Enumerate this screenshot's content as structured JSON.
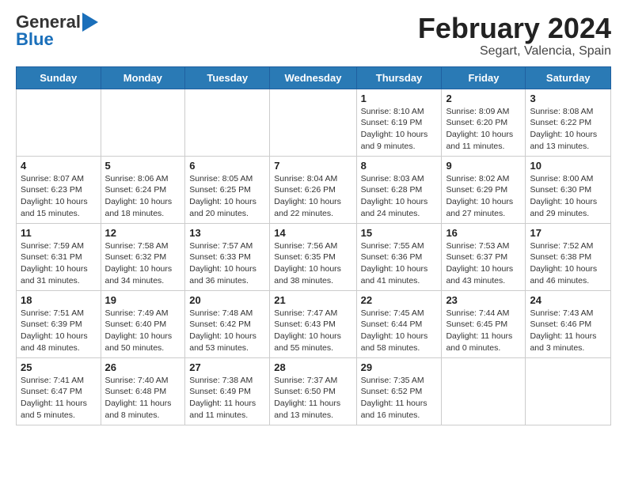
{
  "header": {
    "logo_general": "General",
    "logo_blue": "Blue",
    "month_title": "February 2024",
    "location": "Segart, Valencia, Spain"
  },
  "days_of_week": [
    "Sunday",
    "Monday",
    "Tuesday",
    "Wednesday",
    "Thursday",
    "Friday",
    "Saturday"
  ],
  "weeks": [
    [
      {
        "day": "",
        "info": ""
      },
      {
        "day": "",
        "info": ""
      },
      {
        "day": "",
        "info": ""
      },
      {
        "day": "",
        "info": ""
      },
      {
        "day": "1",
        "info": "Sunrise: 8:10 AM\nSunset: 6:19 PM\nDaylight: 10 hours\nand 9 minutes."
      },
      {
        "day": "2",
        "info": "Sunrise: 8:09 AM\nSunset: 6:20 PM\nDaylight: 10 hours\nand 11 minutes."
      },
      {
        "day": "3",
        "info": "Sunrise: 8:08 AM\nSunset: 6:22 PM\nDaylight: 10 hours\nand 13 minutes."
      }
    ],
    [
      {
        "day": "4",
        "info": "Sunrise: 8:07 AM\nSunset: 6:23 PM\nDaylight: 10 hours\nand 15 minutes."
      },
      {
        "day": "5",
        "info": "Sunrise: 8:06 AM\nSunset: 6:24 PM\nDaylight: 10 hours\nand 18 minutes."
      },
      {
        "day": "6",
        "info": "Sunrise: 8:05 AM\nSunset: 6:25 PM\nDaylight: 10 hours\nand 20 minutes."
      },
      {
        "day": "7",
        "info": "Sunrise: 8:04 AM\nSunset: 6:26 PM\nDaylight: 10 hours\nand 22 minutes."
      },
      {
        "day": "8",
        "info": "Sunrise: 8:03 AM\nSunset: 6:28 PM\nDaylight: 10 hours\nand 24 minutes."
      },
      {
        "day": "9",
        "info": "Sunrise: 8:02 AM\nSunset: 6:29 PM\nDaylight: 10 hours\nand 27 minutes."
      },
      {
        "day": "10",
        "info": "Sunrise: 8:00 AM\nSunset: 6:30 PM\nDaylight: 10 hours\nand 29 minutes."
      }
    ],
    [
      {
        "day": "11",
        "info": "Sunrise: 7:59 AM\nSunset: 6:31 PM\nDaylight: 10 hours\nand 31 minutes."
      },
      {
        "day": "12",
        "info": "Sunrise: 7:58 AM\nSunset: 6:32 PM\nDaylight: 10 hours\nand 34 minutes."
      },
      {
        "day": "13",
        "info": "Sunrise: 7:57 AM\nSunset: 6:33 PM\nDaylight: 10 hours\nand 36 minutes."
      },
      {
        "day": "14",
        "info": "Sunrise: 7:56 AM\nSunset: 6:35 PM\nDaylight: 10 hours\nand 38 minutes."
      },
      {
        "day": "15",
        "info": "Sunrise: 7:55 AM\nSunset: 6:36 PM\nDaylight: 10 hours\nand 41 minutes."
      },
      {
        "day": "16",
        "info": "Sunrise: 7:53 AM\nSunset: 6:37 PM\nDaylight: 10 hours\nand 43 minutes."
      },
      {
        "day": "17",
        "info": "Sunrise: 7:52 AM\nSunset: 6:38 PM\nDaylight: 10 hours\nand 46 minutes."
      }
    ],
    [
      {
        "day": "18",
        "info": "Sunrise: 7:51 AM\nSunset: 6:39 PM\nDaylight: 10 hours\nand 48 minutes."
      },
      {
        "day": "19",
        "info": "Sunrise: 7:49 AM\nSunset: 6:40 PM\nDaylight: 10 hours\nand 50 minutes."
      },
      {
        "day": "20",
        "info": "Sunrise: 7:48 AM\nSunset: 6:42 PM\nDaylight: 10 hours\nand 53 minutes."
      },
      {
        "day": "21",
        "info": "Sunrise: 7:47 AM\nSunset: 6:43 PM\nDaylight: 10 hours\nand 55 minutes."
      },
      {
        "day": "22",
        "info": "Sunrise: 7:45 AM\nSunset: 6:44 PM\nDaylight: 10 hours\nand 58 minutes."
      },
      {
        "day": "23",
        "info": "Sunrise: 7:44 AM\nSunset: 6:45 PM\nDaylight: 11 hours\nand 0 minutes."
      },
      {
        "day": "24",
        "info": "Sunrise: 7:43 AM\nSunset: 6:46 PM\nDaylight: 11 hours\nand 3 minutes."
      }
    ],
    [
      {
        "day": "25",
        "info": "Sunrise: 7:41 AM\nSunset: 6:47 PM\nDaylight: 11 hours\nand 5 minutes."
      },
      {
        "day": "26",
        "info": "Sunrise: 7:40 AM\nSunset: 6:48 PM\nDaylight: 11 hours\nand 8 minutes."
      },
      {
        "day": "27",
        "info": "Sunrise: 7:38 AM\nSunset: 6:49 PM\nDaylight: 11 hours\nand 11 minutes."
      },
      {
        "day": "28",
        "info": "Sunrise: 7:37 AM\nSunset: 6:50 PM\nDaylight: 11 hours\nand 13 minutes."
      },
      {
        "day": "29",
        "info": "Sunrise: 7:35 AM\nSunset: 6:52 PM\nDaylight: 11 hours\nand 16 minutes."
      },
      {
        "day": "",
        "info": ""
      },
      {
        "day": "",
        "info": ""
      }
    ]
  ]
}
